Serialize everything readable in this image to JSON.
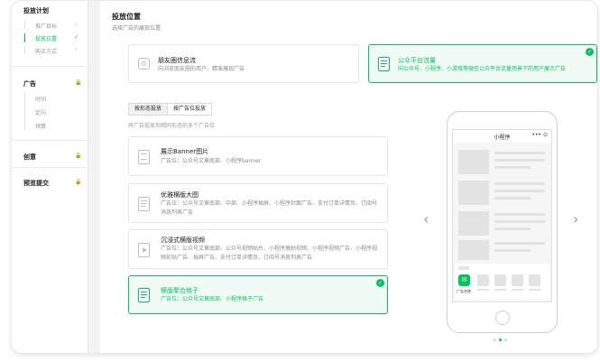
{
  "sidebar": {
    "sections": [
      {
        "title": "投放计划",
        "items": [
          {
            "label": "推广目标",
            "mark": "✓"
          },
          {
            "label": "投放位置",
            "mark": "✓"
          },
          {
            "label": "购买方式",
            "mark": "✓"
          }
        ]
      },
      {
        "title": "广告",
        "mark": "🔒",
        "items": [
          {
            "label": "时间"
          },
          {
            "label": "定向"
          },
          {
            "label": "预算"
          }
        ]
      },
      {
        "title": "创意",
        "mark": "🔒"
      },
      {
        "title": "预览提交",
        "mark": "🔒"
      }
    ]
  },
  "main": {
    "title": "投放位置",
    "subtitle": "选择广告的展现位置"
  },
  "placements": [
    {
      "name": "朋友圈信息流",
      "desc": "向浏览朋友圈的用户、精准展现广告",
      "selected": false
    },
    {
      "name": "公众平台流量",
      "desc": "向公众号、小程序、小游戏等微信公众平台流量场景下的用户展示广告",
      "selected": true
    }
  ],
  "tabs": [
    {
      "label": "按形态投放",
      "active": true
    },
    {
      "label": "按广告位投放",
      "active": false
    }
  ],
  "hint": "将广告投放到相同形态的多个广告位",
  "formats": [
    {
      "name": "展示Banner图片",
      "desc": [
        "广告位：公众号文章底部、小程序banner"
      ],
      "selected": false
    },
    {
      "name": "优雅横版大图",
      "desc": [
        "广告位：公众号文章底部、中部、小程序插屏、小程序封面广告、支付订单详情页、订阅号",
        "消息列表广告"
      ],
      "selected": false
    },
    {
      "name": "沉浸式横版视频",
      "desc": [
        "广告位：公众号文章底部、公众号视频贴片、小程序激励视频、小程序视频广告、小程序视",
        "频前贴广告、插屏广告、支付订单详情页、订阅号消息列表广告"
      ],
      "selected": false
    },
    {
      "name": "横版聚合格子",
      "desc": [
        "广告位：公众号文章底部、小程序格子广告"
      ],
      "selected": true
    }
  ],
  "preview": {
    "screen_title": "小程序",
    "menu": "••• ⊙",
    "ad_label": "广告名称",
    "prev_arrow": "‹",
    "next_arrow": "›",
    "page_dots": 3,
    "active_dot": 2
  },
  "colors": {
    "accent": "#07c160"
  }
}
